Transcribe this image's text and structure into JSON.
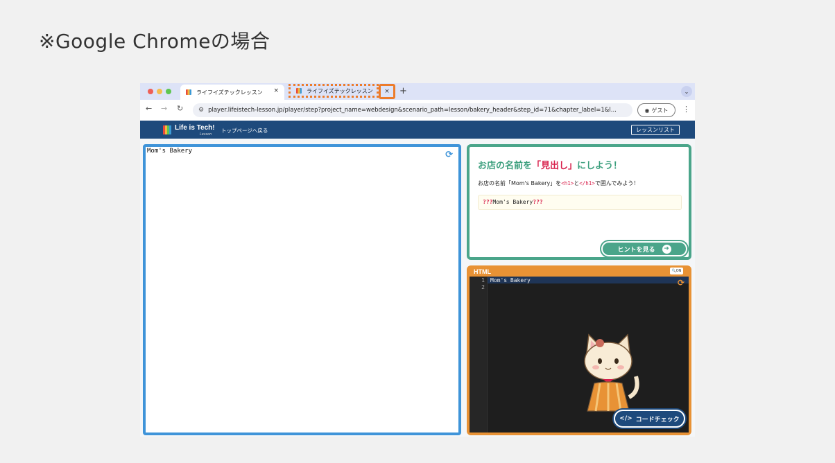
{
  "page_heading": "※Google Chromeの場合",
  "browser": {
    "tabs": [
      {
        "label": "ライフイズテックレッスン",
        "close": "×"
      },
      {
        "label": "ライフイズテックレッスン",
        "close": "×"
      }
    ],
    "new_tab": "+",
    "tab_menu": "⌄",
    "nav": {
      "back": "←",
      "forward": "→",
      "reload": "↻"
    },
    "url": "player.lifeistech-lesson.jp/player/step?project_name=webdesign&scenario_path=lesson/bakery_header&step_id=71&chapter_label=1&l...",
    "profile_label": "ゲスト",
    "menu": "⋮"
  },
  "app": {
    "logo_text": "Life is Tech!",
    "logo_sub": "Lesson",
    "top_link": "トップページへ戻る",
    "lesson_list": "レッスンリスト"
  },
  "preview": {
    "text": "Mom's Bakery"
  },
  "task": {
    "title_pre": "お店の名前を",
    "title_em": "「見出し」",
    "title_post": "にしよう！",
    "desc_pre": "お店の名前「Mom's Bakery」を",
    "tag_open": "<h1>",
    "desc_mid": "と",
    "tag_close": "</h1>",
    "desc_post": "で囲んでみよう！",
    "code_q1": "???",
    "code_text": "Mom's Bakery",
    "code_q2": "???",
    "hint_label": "ヒントを見る"
  },
  "editor": {
    "title": "HTML",
    "zoom_label": "ON",
    "lines": [
      {
        "num": "1",
        "text": "Mom's Bakery"
      },
      {
        "num": "2",
        "text": ""
      }
    ],
    "check_label": "コードチェック",
    "check_icon": "</>"
  },
  "colors": {
    "accent_orange": "#ec7b2a",
    "preview_border": "#3f94d9",
    "task_border": "#4aa58a",
    "editor_frame": "#e89235",
    "app_header": "#1e4a7c",
    "highlight_red": "#d8224d"
  }
}
